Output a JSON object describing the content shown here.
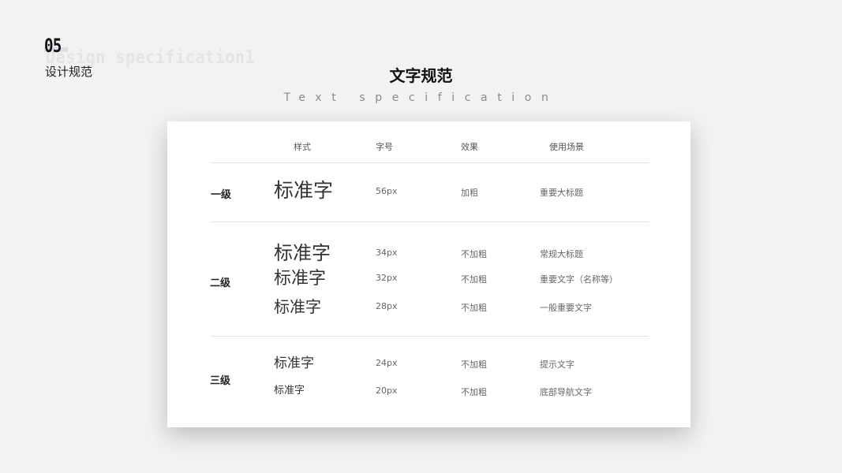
{
  "header": {
    "section_number": "05",
    "background_word": "Design specification1",
    "section_name": "设计规范",
    "title": "文字规范",
    "subtitle": "Text specification"
  },
  "table": {
    "columns": [
      "样式",
      "字号",
      "效果",
      "使用场景"
    ],
    "groups": [
      {
        "level": "一级",
        "rows": [
          {
            "sample": "标准字",
            "size": "56px",
            "effect": "加粗",
            "usage": "重要大标题"
          }
        ]
      },
      {
        "level": "二级",
        "rows": [
          {
            "sample": "标准字",
            "size": "34px",
            "effect": "不加粗",
            "usage": "常规大标题"
          },
          {
            "sample": "标准字",
            "size": "32px",
            "effect": "不加粗",
            "usage": "重要文字（名称等）"
          },
          {
            "sample": "标准字",
            "size": "28px",
            "effect": "不加粗",
            "usage": "一般重要文字"
          }
        ]
      },
      {
        "level": "三级",
        "rows": [
          {
            "sample": "标准字",
            "size": "24px",
            "effect": "不加粗",
            "usage": "提示文字"
          },
          {
            "sample": "标准字",
            "size": "20px",
            "effect": "不加粗",
            "usage": "底部导航文字"
          }
        ]
      }
    ]
  }
}
